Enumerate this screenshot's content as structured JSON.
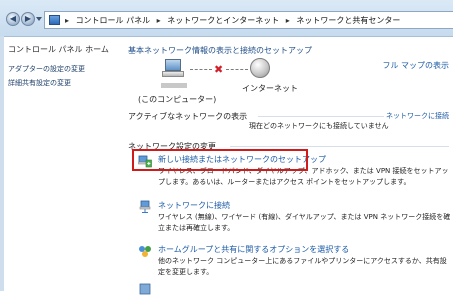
{
  "address_bar": {
    "crumbs": [
      "コントロール パネル",
      "ネットワークとインターネット",
      "ネットワークと共有センター"
    ],
    "separator": "▸"
  },
  "sidebar": {
    "home": "コントロール パネル ホーム",
    "links": [
      "アダプターの設定の変更",
      "詳細共有設定の変更"
    ]
  },
  "main": {
    "title": "基本ネットワーク情報の表示と接続のセットアップ",
    "full_map_link": "フル マップの表示",
    "computer_label": "(このコンピューター)",
    "internet_label": "インターネット",
    "active_networks_heading": "アクティブなネットワークの表示",
    "connect_link": "ネットワークに接続",
    "no_connection_text": "現在どのネットワークにも接続していません",
    "change_settings_heading": "ネットワーク設定の変更",
    "tasks": [
      {
        "title": "新しい接続またはネットワークのセットアップ",
        "desc": "ワイヤレス、ブロードバンド、ダイヤルアップ、アドホック、または VPN 接続をセットアップします。あるいは、ルーターまたはアクセス ポイントをセットアップします。"
      },
      {
        "title": "ネットワークに接続",
        "desc": "ワイヤレス (無線)、ワイヤード (有線)、ダイヤルアップ、または VPN ネットワーク接続を確立または再確立します。"
      },
      {
        "title": "ホームグループと共有に関するオプションを選択する",
        "desc": "他のネットワーク コンピューター上にあるファイルやプリンターにアクセスするか、共有設定を変更します。"
      }
    ]
  },
  "icons": {
    "back": "back-arrow-icon",
    "forward": "forward-arrow-icon",
    "control_panel": "control-panel-icon",
    "computer": "computer-icon",
    "internet": "globe-icon",
    "setup": "network-setup-icon",
    "connect": "network-connect-icon",
    "homegroup": "homegroup-icon"
  },
  "colors": {
    "link": "#1a5aa6",
    "heading": "#1e4e8a",
    "highlight": "#d11a1a",
    "disconnect": "#d2202a"
  }
}
